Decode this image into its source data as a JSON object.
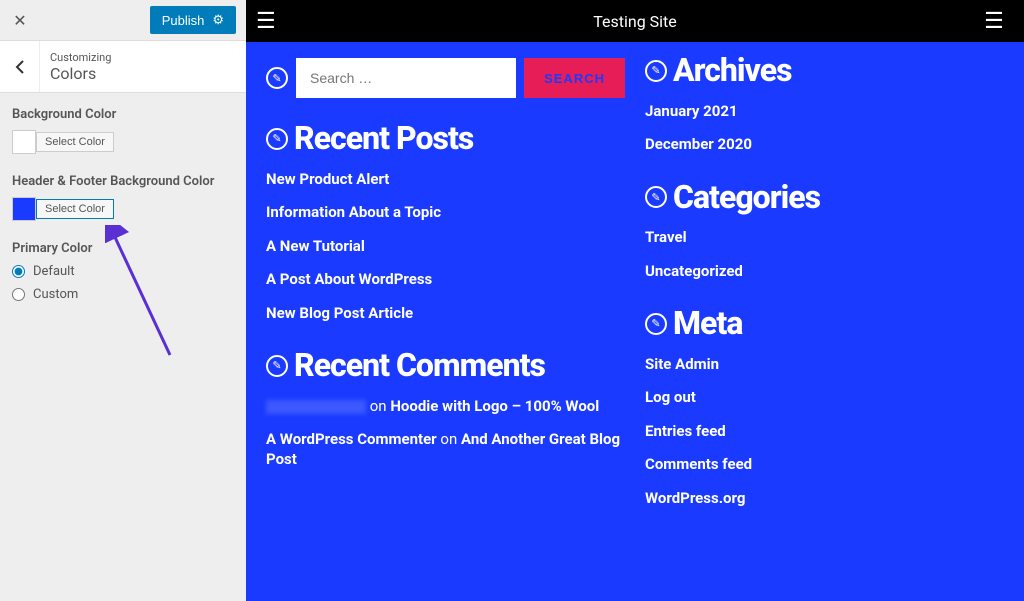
{
  "sidebar": {
    "publish_label": "Publish",
    "breadcrumb_label": "Customizing",
    "breadcrumb_title": "Colors",
    "bg_color_label": "Background Color",
    "bg_color_button": "Select Color",
    "hf_color_label": "Header & Footer Background Color",
    "hf_color_button": "Select Color",
    "primary_label": "Primary Color",
    "radio_default": "Default",
    "radio_custom": "Custom"
  },
  "preview": {
    "site_title": "Testing Site",
    "search_placeholder": "Search …",
    "search_button": "SEARCH",
    "recent_posts_title": "Recent Posts",
    "recent_posts": [
      "New Product Alert",
      "Information About a Topic",
      "A New Tutorial",
      "A Post About WordPress",
      "New Blog Post Article"
    ],
    "recent_comments_title": "Recent Comments",
    "comment1_on": "on",
    "comment1_link": "Hoodie with Logo – 100% Wool",
    "comment2_author": "A WordPress Commenter",
    "comment2_on": "on",
    "comment2_link": "And Another Great Blog Post",
    "archives_title": "Archives",
    "archives": [
      "January 2021",
      "December 2020"
    ],
    "categories_title": "Categories",
    "categories": [
      "Travel",
      "Uncategorized"
    ],
    "meta_title": "Meta",
    "meta_links": [
      "Site Admin",
      "Log out",
      "Entries feed",
      "Comments feed",
      "WordPress.org"
    ]
  },
  "colors": {
    "accent": "#1a3bff",
    "search_btn": "#e71d57"
  }
}
